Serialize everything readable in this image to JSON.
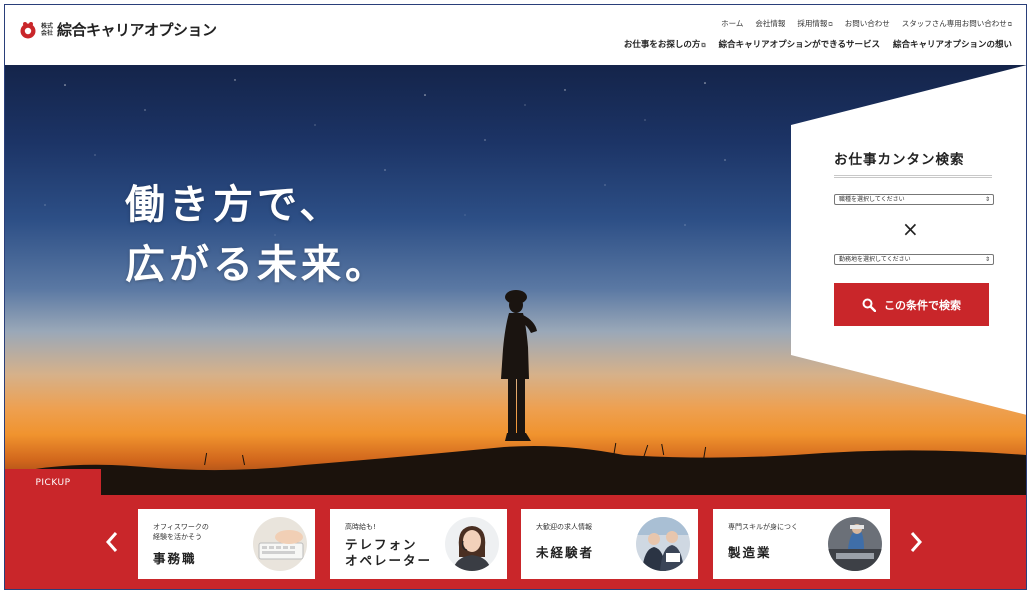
{
  "brand": {
    "kabushiki": [
      "株式",
      "会社"
    ],
    "name": "綜合キャリアオプション",
    "accent_color": "#c9262a"
  },
  "util_nav": [
    {
      "label": "ホーム",
      "external": false
    },
    {
      "label": "会社情報",
      "external": false
    },
    {
      "label": "採用情報",
      "external": true
    },
    {
      "label": "お問い合わせ",
      "external": false
    },
    {
      "label": "スタッフさん専用お問い合わせ",
      "external": true
    }
  ],
  "main_nav": [
    {
      "label": "お仕事をお探しの方",
      "external": true
    },
    {
      "label": "綜合キャリアオプションができるサービス",
      "external": false
    },
    {
      "label": "綜合キャリアオプションの想い",
      "external": false
    }
  ],
  "hero": {
    "tagline_line1": "働き方で、",
    "tagline_line2": "広がる未来。"
  },
  "search": {
    "title": "お仕事カンタン検索",
    "job_select": "職種を選択してください",
    "area_select": "勤務地を選択してください",
    "times": "×",
    "button_label": "この条件で検索",
    "button_icon": "search-icon"
  },
  "pickup": {
    "tab_label": "PICKUP",
    "prev_icon": "chevron-left-icon",
    "next_icon": "chevron-right-icon",
    "cards": [
      {
        "small": "オフィスワークの\n経験を活かそう",
        "big": "事務職",
        "icon": "keyboard-photo"
      },
      {
        "small": "高時給も!",
        "big": "テレフォン\nオペレーター",
        "icon": "operator-photo"
      },
      {
        "small": "大歓迎の求人情報",
        "big": "未経験者",
        "icon": "team-photo"
      },
      {
        "small": "専門スキルが身につく",
        "big": "製造業",
        "icon": "factory-photo"
      }
    ]
  }
}
